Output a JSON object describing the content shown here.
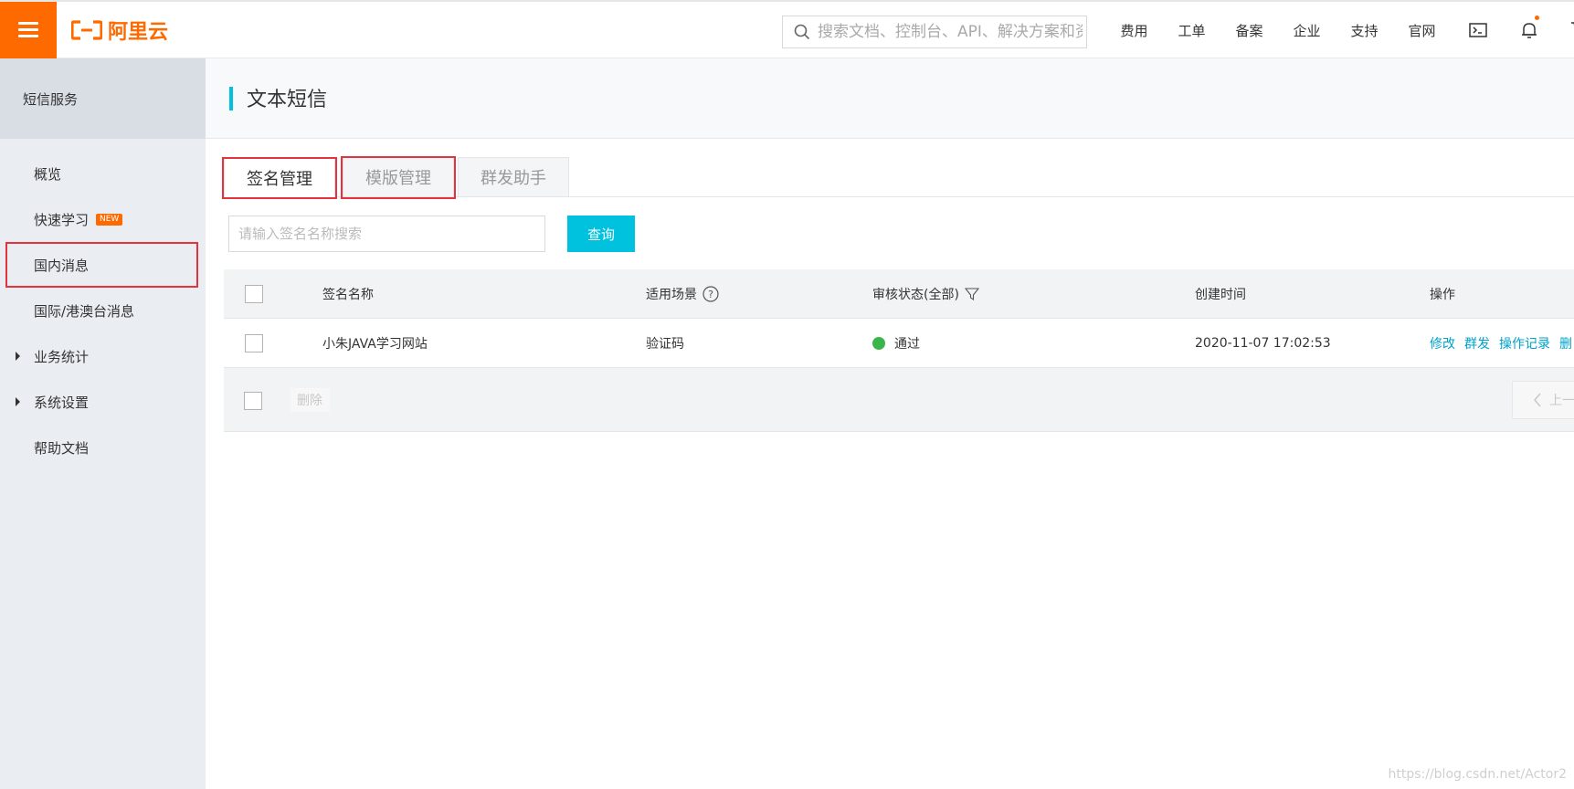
{
  "header": {
    "logo_text": "阿里云",
    "search_placeholder": "搜索文档、控制台、API、解决方案和资源",
    "nav": [
      "费用",
      "工单",
      "备案",
      "企业",
      "支持",
      "官网"
    ],
    "icons": [
      "terminal-icon",
      "bell-icon",
      "cart-icon"
    ]
  },
  "sidebar": {
    "title": "短信服务",
    "items": [
      {
        "label": "概览"
      },
      {
        "label": "快速学习",
        "badge": "NEW"
      },
      {
        "label": "国内消息"
      },
      {
        "label": "国际/港澳台消息"
      },
      {
        "label": "业务统计"
      },
      {
        "label": "系统设置"
      },
      {
        "label": "帮助文档"
      }
    ]
  },
  "page": {
    "title": "文本短信",
    "tabs": [
      "签名管理",
      "模版管理",
      "群发助手"
    ],
    "search_placeholder": "请输入签名名称搜索",
    "query_label": "查询"
  },
  "table": {
    "headers": {
      "name": "签名名称",
      "scene": "适用场景",
      "status": "审核状态(全部)",
      "created": "创建时间",
      "actions": "操作"
    },
    "rows": [
      {
        "name": "小朱JAVA学习网站",
        "scene": "验证码",
        "status": "通过",
        "created": "2020-11-07 17:02:53",
        "actions": [
          "修改",
          "群发",
          "操作记录",
          "删"
        ]
      }
    ],
    "delete_label": "删除",
    "prev_label": "上一"
  },
  "watermark": "https://blog.csdn.net/Actor2",
  "colors": {
    "brand_orange": "#ff6a00",
    "accent_cyan": "#00c1de",
    "link_blue": "#00a2ca",
    "status_green": "#3ab54a",
    "highlight_red": "#e5323e"
  }
}
